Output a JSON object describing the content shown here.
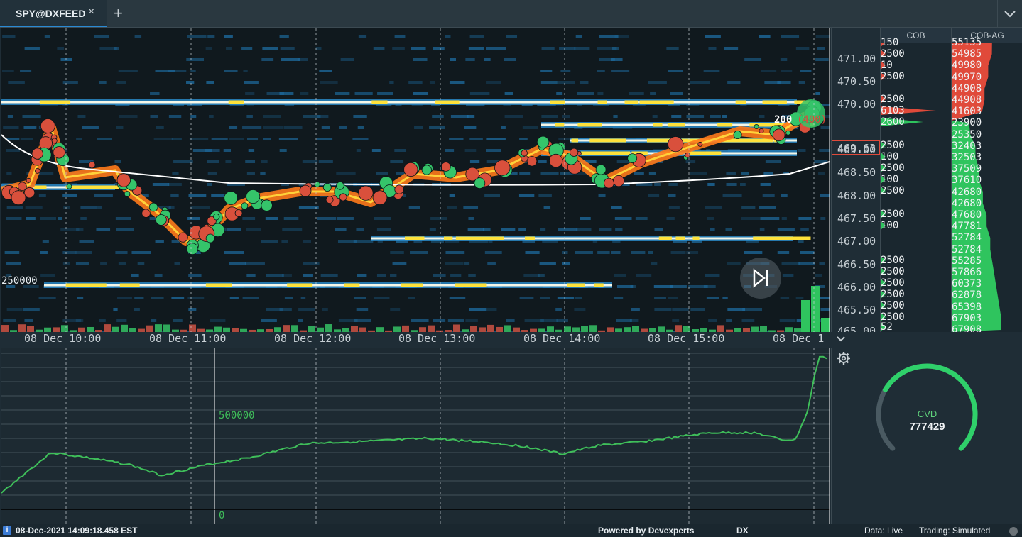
{
  "tabs": [
    {
      "label": "SPY@DXFEED",
      "active": true
    }
  ],
  "tab_add_symbol": "+",
  "tab_close_symbol": "×",
  "columns": {
    "cob": "COB",
    "cob_ag": "COB-AG"
  },
  "price_axis": {
    "labels": [
      "471.00",
      "470.50",
      "470.00",
      "469.00",
      "468.50",
      "468.00",
      "467.50",
      "467.00",
      "466.50",
      "466.00",
      "465.50",
      "465.00"
    ],
    "current_price": "469.63"
  },
  "chart": {
    "volume_scale_label": "250000",
    "trade_annotation": "200",
    "trade_annotation_paren": "(400)"
  },
  "cob_values": [
    "150",
    "2500",
    "10",
    "2500",
    "2500",
    "6103",
    "2600",
    "2500",
    "100",
    "2500",
    "100",
    "2500",
    "2500",
    "100",
    "2500",
    "2500",
    "2500",
    "2500",
    "2500",
    "2500",
    "52"
  ],
  "cob_ag_values": [
    "55135",
    "54985",
    "49980",
    "49970",
    "44908",
    "44908",
    "41603",
    "23900",
    "25350",
    "32403",
    "32503",
    "37509",
    "37610",
    "42680",
    "42680",
    "47680",
    "47781",
    "52784",
    "52784",
    "55285",
    "57866",
    "60373",
    "62878",
    "65398",
    "67903",
    "67908"
  ],
  "time_labels": [
    "08 Dec 10:00",
    "08 Dec 11:00",
    "08 Dec 12:00",
    "08 Dec 13:00",
    "08 Dec 14:00",
    "08 Dec 15:00",
    "08 Dec 1"
  ],
  "cvd": {
    "scale_label_top": "500000",
    "scale_label_zero": "0",
    "label": "CVD",
    "value": "777429",
    "fraction": 0.72
  },
  "status": {
    "datetime": "08-Dec-2021 14:09:18.458 EST",
    "powered_by": "Powered by Devexperts",
    "dx": "DX",
    "data": "Data: Live",
    "trading": "Trading: Simulated"
  },
  "colors": {
    "bid": "#2fc45e",
    "ask": "#e04a3a",
    "accent": "#2a8ad4",
    "cvd_line": "#3fbf5a",
    "background": "#10191e"
  }
}
